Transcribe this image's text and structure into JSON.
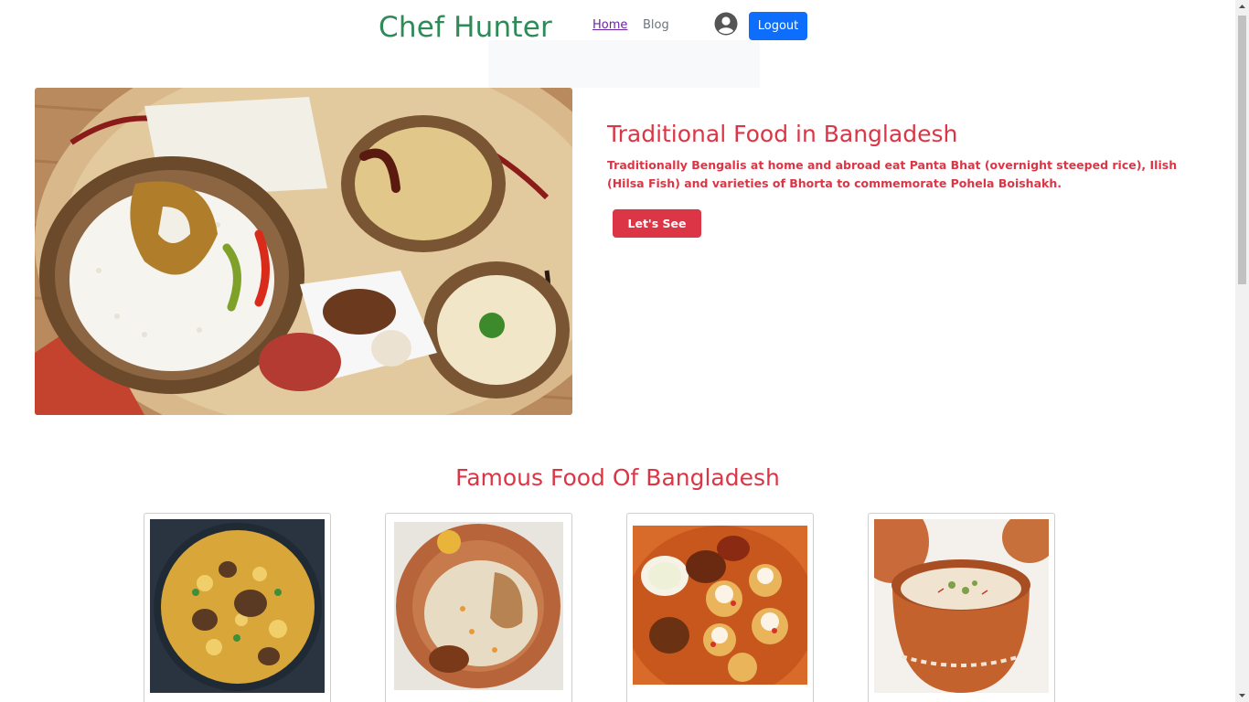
{
  "header": {
    "brand": "Chef Hunter",
    "nav": {
      "home": "Home",
      "blog": "Blog"
    },
    "logout_label": "Logout",
    "avatar_icon": "user-circle-icon"
  },
  "hero": {
    "title": "Traditional Food in Bangladesh",
    "text": "Traditionally Bengalis at home and abroad eat Panta Bhat (overnight steeped rice), Ilish (Hilsa Fish) and varieties of Bhorta to commemorate Pohela Boishakh.",
    "button_label": "Let's See"
  },
  "famous": {
    "title": "Famous Food Of Bangladesh",
    "cards": [
      {
        "image": "biryani-plate"
      },
      {
        "image": "rice-with-egg-plate"
      },
      {
        "image": "fuchka-plate"
      },
      {
        "image": "clay-pot-dessert"
      }
    ]
  },
  "colors": {
    "brand": "#2e8b57",
    "accent_red": "#dc3545",
    "primary_blue": "#0d6efd"
  }
}
